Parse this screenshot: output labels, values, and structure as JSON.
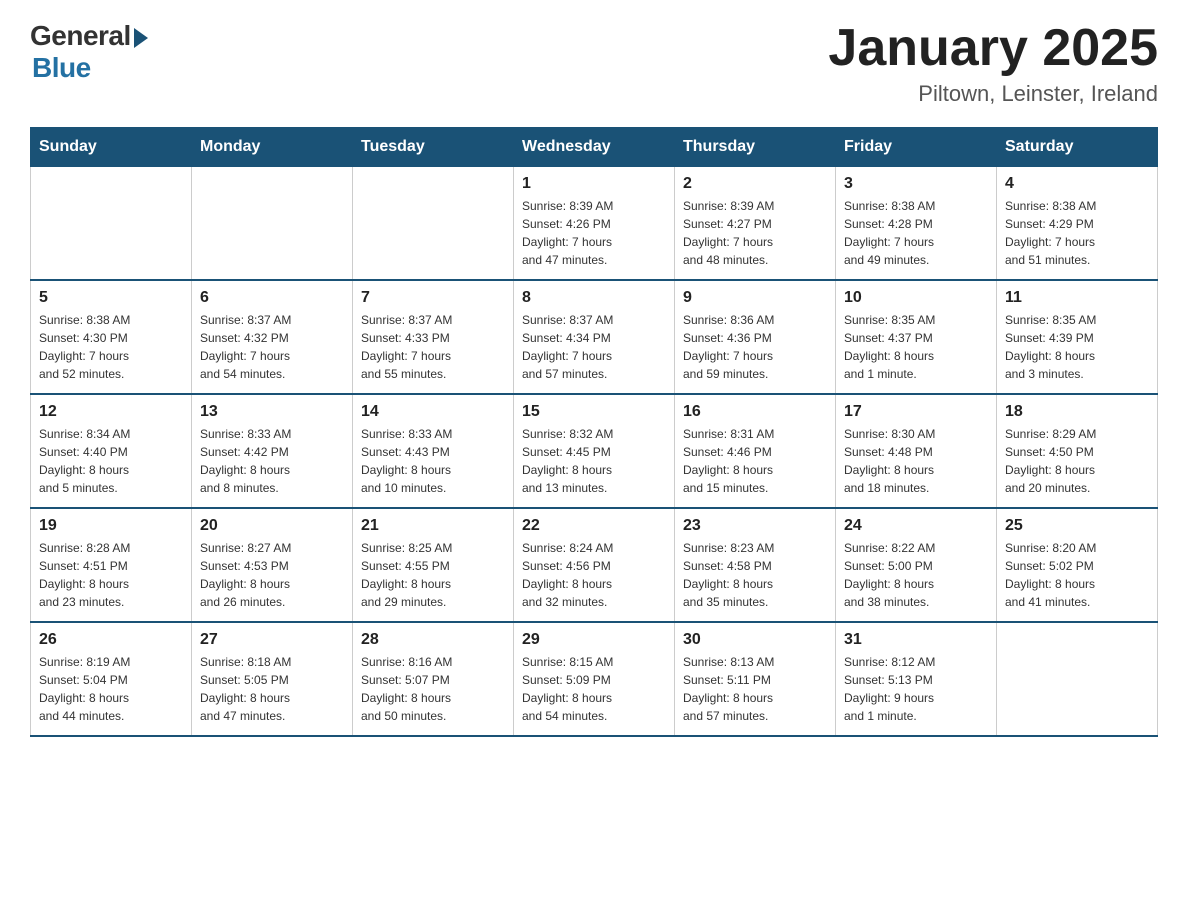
{
  "logo": {
    "general": "General",
    "blue": "Blue"
  },
  "title": "January 2025",
  "subtitle": "Piltown, Leinster, Ireland",
  "weekdays": [
    "Sunday",
    "Monday",
    "Tuesday",
    "Wednesday",
    "Thursday",
    "Friday",
    "Saturday"
  ],
  "weeks": [
    [
      {
        "day": "",
        "info": ""
      },
      {
        "day": "",
        "info": ""
      },
      {
        "day": "",
        "info": ""
      },
      {
        "day": "1",
        "info": "Sunrise: 8:39 AM\nSunset: 4:26 PM\nDaylight: 7 hours\nand 47 minutes."
      },
      {
        "day": "2",
        "info": "Sunrise: 8:39 AM\nSunset: 4:27 PM\nDaylight: 7 hours\nand 48 minutes."
      },
      {
        "day": "3",
        "info": "Sunrise: 8:38 AM\nSunset: 4:28 PM\nDaylight: 7 hours\nand 49 minutes."
      },
      {
        "day": "4",
        "info": "Sunrise: 8:38 AM\nSunset: 4:29 PM\nDaylight: 7 hours\nand 51 minutes."
      }
    ],
    [
      {
        "day": "5",
        "info": "Sunrise: 8:38 AM\nSunset: 4:30 PM\nDaylight: 7 hours\nand 52 minutes."
      },
      {
        "day": "6",
        "info": "Sunrise: 8:37 AM\nSunset: 4:32 PM\nDaylight: 7 hours\nand 54 minutes."
      },
      {
        "day": "7",
        "info": "Sunrise: 8:37 AM\nSunset: 4:33 PM\nDaylight: 7 hours\nand 55 minutes."
      },
      {
        "day": "8",
        "info": "Sunrise: 8:37 AM\nSunset: 4:34 PM\nDaylight: 7 hours\nand 57 minutes."
      },
      {
        "day": "9",
        "info": "Sunrise: 8:36 AM\nSunset: 4:36 PM\nDaylight: 7 hours\nand 59 minutes."
      },
      {
        "day": "10",
        "info": "Sunrise: 8:35 AM\nSunset: 4:37 PM\nDaylight: 8 hours\nand 1 minute."
      },
      {
        "day": "11",
        "info": "Sunrise: 8:35 AM\nSunset: 4:39 PM\nDaylight: 8 hours\nand 3 minutes."
      }
    ],
    [
      {
        "day": "12",
        "info": "Sunrise: 8:34 AM\nSunset: 4:40 PM\nDaylight: 8 hours\nand 5 minutes."
      },
      {
        "day": "13",
        "info": "Sunrise: 8:33 AM\nSunset: 4:42 PM\nDaylight: 8 hours\nand 8 minutes."
      },
      {
        "day": "14",
        "info": "Sunrise: 8:33 AM\nSunset: 4:43 PM\nDaylight: 8 hours\nand 10 minutes."
      },
      {
        "day": "15",
        "info": "Sunrise: 8:32 AM\nSunset: 4:45 PM\nDaylight: 8 hours\nand 13 minutes."
      },
      {
        "day": "16",
        "info": "Sunrise: 8:31 AM\nSunset: 4:46 PM\nDaylight: 8 hours\nand 15 minutes."
      },
      {
        "day": "17",
        "info": "Sunrise: 8:30 AM\nSunset: 4:48 PM\nDaylight: 8 hours\nand 18 minutes."
      },
      {
        "day": "18",
        "info": "Sunrise: 8:29 AM\nSunset: 4:50 PM\nDaylight: 8 hours\nand 20 minutes."
      }
    ],
    [
      {
        "day": "19",
        "info": "Sunrise: 8:28 AM\nSunset: 4:51 PM\nDaylight: 8 hours\nand 23 minutes."
      },
      {
        "day": "20",
        "info": "Sunrise: 8:27 AM\nSunset: 4:53 PM\nDaylight: 8 hours\nand 26 minutes."
      },
      {
        "day": "21",
        "info": "Sunrise: 8:25 AM\nSunset: 4:55 PM\nDaylight: 8 hours\nand 29 minutes."
      },
      {
        "day": "22",
        "info": "Sunrise: 8:24 AM\nSunset: 4:56 PM\nDaylight: 8 hours\nand 32 minutes."
      },
      {
        "day": "23",
        "info": "Sunrise: 8:23 AM\nSunset: 4:58 PM\nDaylight: 8 hours\nand 35 minutes."
      },
      {
        "day": "24",
        "info": "Sunrise: 8:22 AM\nSunset: 5:00 PM\nDaylight: 8 hours\nand 38 minutes."
      },
      {
        "day": "25",
        "info": "Sunrise: 8:20 AM\nSunset: 5:02 PM\nDaylight: 8 hours\nand 41 minutes."
      }
    ],
    [
      {
        "day": "26",
        "info": "Sunrise: 8:19 AM\nSunset: 5:04 PM\nDaylight: 8 hours\nand 44 minutes."
      },
      {
        "day": "27",
        "info": "Sunrise: 8:18 AM\nSunset: 5:05 PM\nDaylight: 8 hours\nand 47 minutes."
      },
      {
        "day": "28",
        "info": "Sunrise: 8:16 AM\nSunset: 5:07 PM\nDaylight: 8 hours\nand 50 minutes."
      },
      {
        "day": "29",
        "info": "Sunrise: 8:15 AM\nSunset: 5:09 PM\nDaylight: 8 hours\nand 54 minutes."
      },
      {
        "day": "30",
        "info": "Sunrise: 8:13 AM\nSunset: 5:11 PM\nDaylight: 8 hours\nand 57 minutes."
      },
      {
        "day": "31",
        "info": "Sunrise: 8:12 AM\nSunset: 5:13 PM\nDaylight: 9 hours\nand 1 minute."
      },
      {
        "day": "",
        "info": ""
      }
    ]
  ]
}
